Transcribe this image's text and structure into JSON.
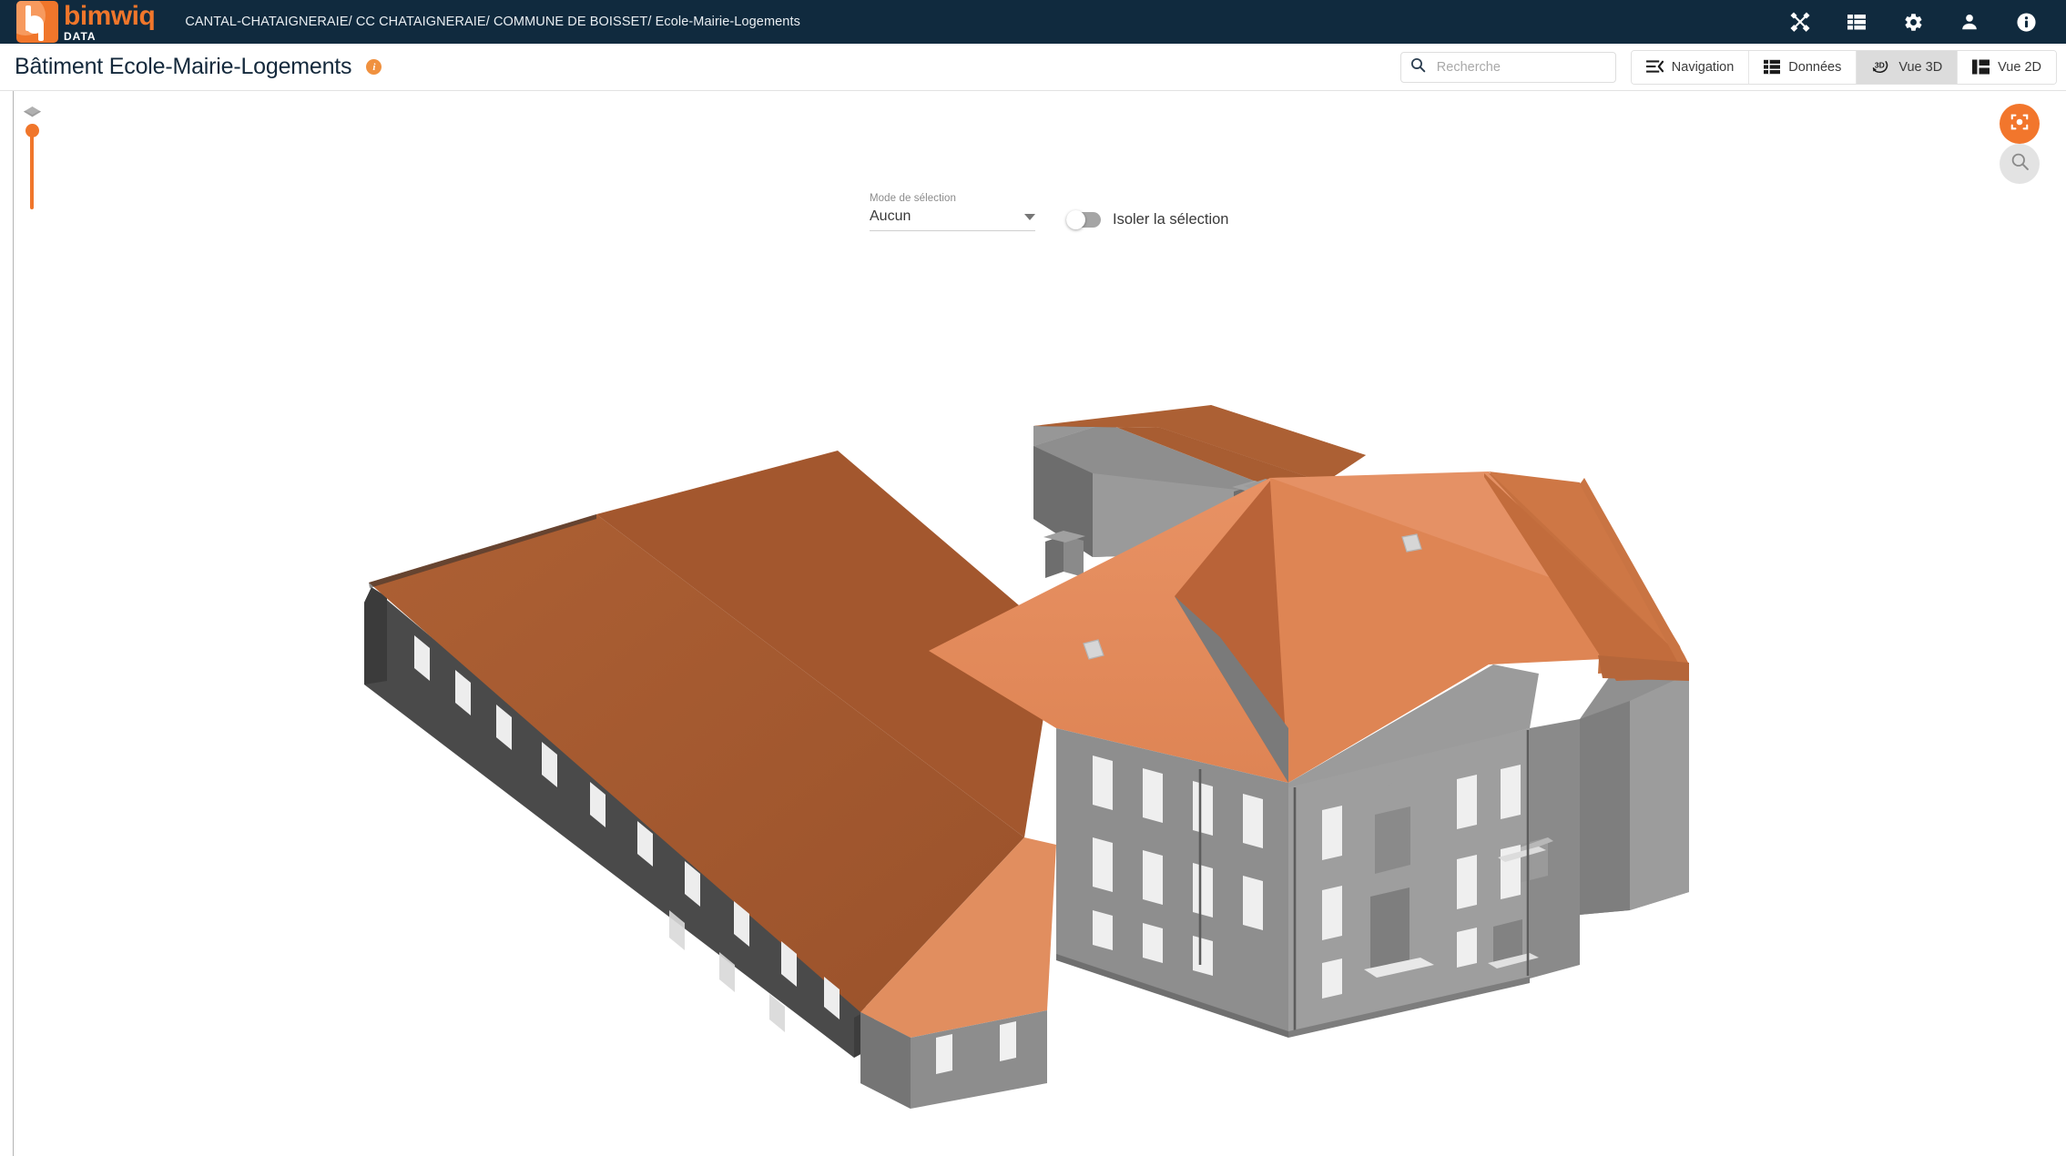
{
  "header": {
    "logo": {
      "name": "bimwiq",
      "sub": "DATA",
      "mark_color": "#F0762B",
      "name_color": "#F0762B"
    },
    "breadcrumb": "CANTAL-CHATAIGNERAIE/ CC CHATAIGNERAIE/ COMMUNE DE BOISSET/ Ecole-Mairie-Logements",
    "background_color": "#102A3E",
    "icons": [
      {
        "name": "tools-icon"
      },
      {
        "name": "list-icon"
      },
      {
        "name": "gear-icon"
      },
      {
        "name": "user-icon"
      },
      {
        "name": "info-icon"
      }
    ]
  },
  "subbar": {
    "title": "Bâtiment Ecole-Mairie-Logements",
    "info_badge": "i",
    "info_badge_color": "#F0913F",
    "search": {
      "placeholder": "Recherche",
      "value": ""
    },
    "buttons": [
      {
        "label": "Navigation",
        "icon": "navigation-collapse-icon",
        "active": false
      },
      {
        "label": "Données",
        "icon": "data-list-icon",
        "active": false
      },
      {
        "label": "Vue 3D",
        "icon": "view-3d-icon",
        "active": true
      },
      {
        "label": "Vue 2D",
        "icon": "view-2d-icon",
        "active": false
      }
    ]
  },
  "viewport": {
    "layers_icon": "layers-icon",
    "slider": {
      "name": "section-slider",
      "value": 100,
      "color": "#F0762B"
    },
    "selection": {
      "mode_label": "Mode de sélection",
      "mode_value": "Aucun",
      "isolate_label": "Isoler la sélection",
      "isolate_on": false
    },
    "fab": [
      {
        "name": "focus-center-button",
        "icon": "focus-target-icon",
        "color": "#F2762C"
      },
      {
        "name": "zoom-button",
        "icon": "magnifier-icon",
        "color": "#e3e3e3"
      }
    ],
    "model": {
      "description": "3D BIM model of a school / town-hall / housing building",
      "roof_light_color": "#E5905E",
      "roof_mid_color": "#D97E4A",
      "roof_dark_color": "#A55C31",
      "wall_light_color": "#9E9E9E",
      "wall_mid_color": "#8A8A8A",
      "wall_dark_color": "#494949",
      "window_color": "#F2F2F2"
    }
  }
}
